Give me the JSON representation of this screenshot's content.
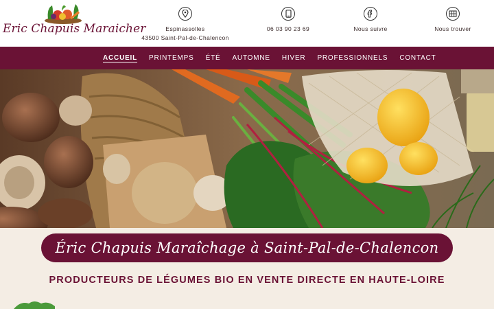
{
  "header": {
    "logo_text": "Eric Chapuis Maraicher",
    "address": {
      "icon": "map-pin-icon",
      "line1": "Espinassolles",
      "line2": "43500 Saint-Pal-de-Chalencon"
    },
    "phone": {
      "icon": "phone-icon",
      "line1": "06 03 90 23 69"
    },
    "follow": {
      "icon": "social-icon",
      "line1": "Nous suivre"
    },
    "find": {
      "icon": "map-icon",
      "line1": "Nous trouver"
    }
  },
  "nav": {
    "items": [
      {
        "label": "ACCUEIL",
        "active": true
      },
      {
        "label": "PRINTEMPS"
      },
      {
        "label": "ÉTÉ"
      },
      {
        "label": "AUTOMNE"
      },
      {
        "label": "HIVER"
      },
      {
        "label": "PROFESSIONNELS"
      },
      {
        "label": "CONTACT"
      }
    ]
  },
  "hero": {
    "image": "vegetables-in-basket-photo"
  },
  "banner": {
    "title": "Éric Chapuis Maraîchage à Saint-Pal-de-Chalencon"
  },
  "subtitle": "PRODUCTEURS DE LÉGUMES BIO EN VENTE DIRECTE EN HAUTE-LOIRE",
  "colors": {
    "brand": "#6a1235",
    "background": "#f4ede4",
    "white": "#ffffff"
  }
}
